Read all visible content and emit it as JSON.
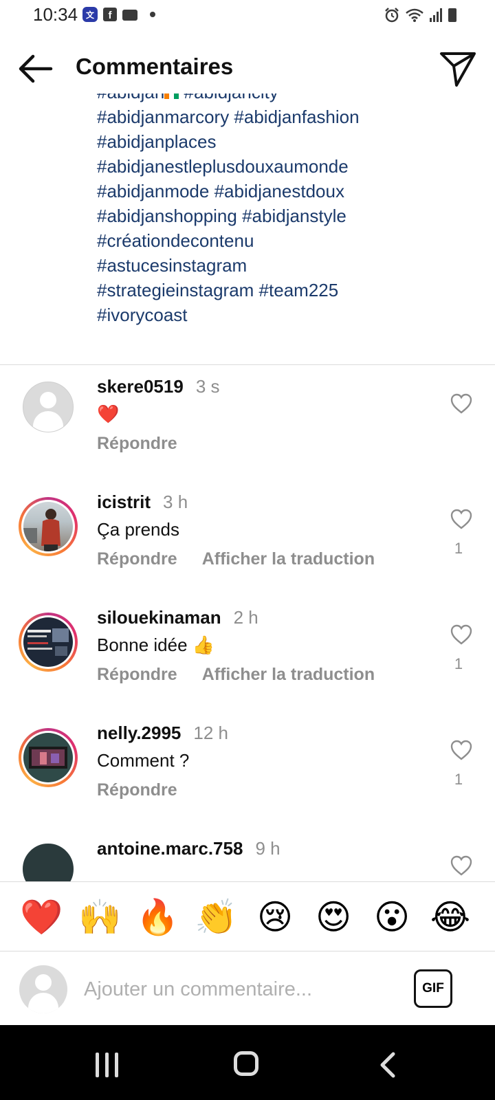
{
  "status_bar": {
    "time": "10:34",
    "left_icons": [
      "translate-app-icon",
      "facebook-icon",
      "video-camera-icon",
      "dot-indicator"
    ],
    "right_icons": [
      "alarm-icon",
      "wifi-icon",
      "signal-icon",
      "battery-icon"
    ]
  },
  "header": {
    "title": "Commentaires"
  },
  "caption": {
    "lines": [
      {
        "before": "#abidjan",
        "after": " #abidjancity",
        "has_flag": true
      },
      {
        "text": "#abidjanmarcory #abidjanfashion"
      },
      {
        "text": "#abidjanplaces"
      },
      {
        "text": "#abidjanestleplusdouxaumonde"
      },
      {
        "text": "#abidjanmode #abidjanestdoux"
      },
      {
        "text": "#abidjanshopping #abidjanstyle"
      },
      {
        "text": "#créationdecontenu"
      },
      {
        "text": "#astucesinstagram"
      },
      {
        "text": "#strategieinstagram #team225"
      },
      {
        "text": "#ivorycoast"
      }
    ],
    "flag_colors": [
      "#F77F00",
      "#FFFFFF",
      "#009E60"
    ]
  },
  "comments": [
    {
      "username": "skere0519",
      "time": "3 s",
      "text": "❤️",
      "reply": "Répondre",
      "translate": "",
      "likes": ""
    },
    {
      "username": "icistrit",
      "time": "3 h",
      "text": "Ça prends",
      "reply": "Répondre",
      "translate": "Afficher la traduction",
      "likes": "1"
    },
    {
      "username": "silouekinaman",
      "time": "2 h",
      "text": "Bonne idée 👍",
      "reply": "Répondre",
      "translate": "Afficher la traduction",
      "likes": "1"
    },
    {
      "username": "nelly.2995",
      "time": "12 h",
      "text": "Comment ?",
      "reply": "Répondre",
      "translate": "",
      "likes": "1"
    },
    {
      "username": "antoine.marc.758",
      "time": "9 h",
      "text": "",
      "reply": "",
      "translate": "",
      "likes": ""
    }
  ],
  "emoji_bar": [
    "❤️",
    "🙌",
    "🔥",
    "👏",
    "😢",
    "😍",
    "😮",
    "😂"
  ],
  "input": {
    "placeholder": "Ajouter un commentaire...",
    "value": "",
    "gif_label": "GIF"
  },
  "colors": {
    "hashtag": "#1b3a6b",
    "secondary_text": "#8e8e8e",
    "divider": "#dbdbdb",
    "story_ring_start": "#c13584",
    "story_ring_end": "#fcaf45"
  }
}
